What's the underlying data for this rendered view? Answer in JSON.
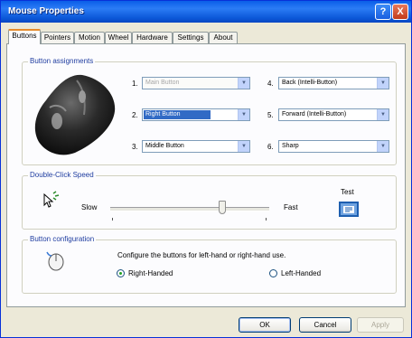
{
  "window": {
    "title": "Mouse Properties"
  },
  "titlebar_buttons": {
    "help": "?",
    "close": "X"
  },
  "tabs": [
    "Buttons",
    "Pointers",
    "Motion",
    "Wheel",
    "Hardware",
    "Settings",
    "About"
  ],
  "active_tab": "Buttons",
  "button_assignments": {
    "title": "Button assignments",
    "items": [
      {
        "number": "1.",
        "value": "Main Button",
        "disabled": true
      },
      {
        "number": "2.",
        "value": "Right Button",
        "selected": true
      },
      {
        "number": "3.",
        "value": "Middle Button"
      },
      {
        "number": "4.",
        "value": "Back (Intelli-Button)"
      },
      {
        "number": "5.",
        "value": "Forward (Intelli-Button)"
      },
      {
        "number": "6.",
        "value": "Sharp"
      }
    ]
  },
  "double_click_speed": {
    "title": "Double-Click Speed",
    "slow_label": "Slow",
    "fast_label": "Fast",
    "test_label": "Test",
    "slider_fraction": 0.7
  },
  "button_configuration": {
    "title": "Button configuration",
    "description": "Configure the buttons for left-hand or right-hand use.",
    "options": [
      {
        "label": "Right-Handed",
        "checked": true
      },
      {
        "label": "Left-Handed",
        "checked": false
      }
    ]
  },
  "footer": {
    "ok": "OK",
    "cancel": "Cancel",
    "apply": "Apply"
  },
  "colors": {
    "titlebar": "#0a5ee8",
    "tab_highlight": "#e68b2c",
    "selection": "#316ac5"
  },
  "icons": {
    "mouse": "mouse-icon",
    "double_click": "double-click-icon",
    "test_area": "folder-test-icon",
    "config": "mouse-config-icon"
  }
}
